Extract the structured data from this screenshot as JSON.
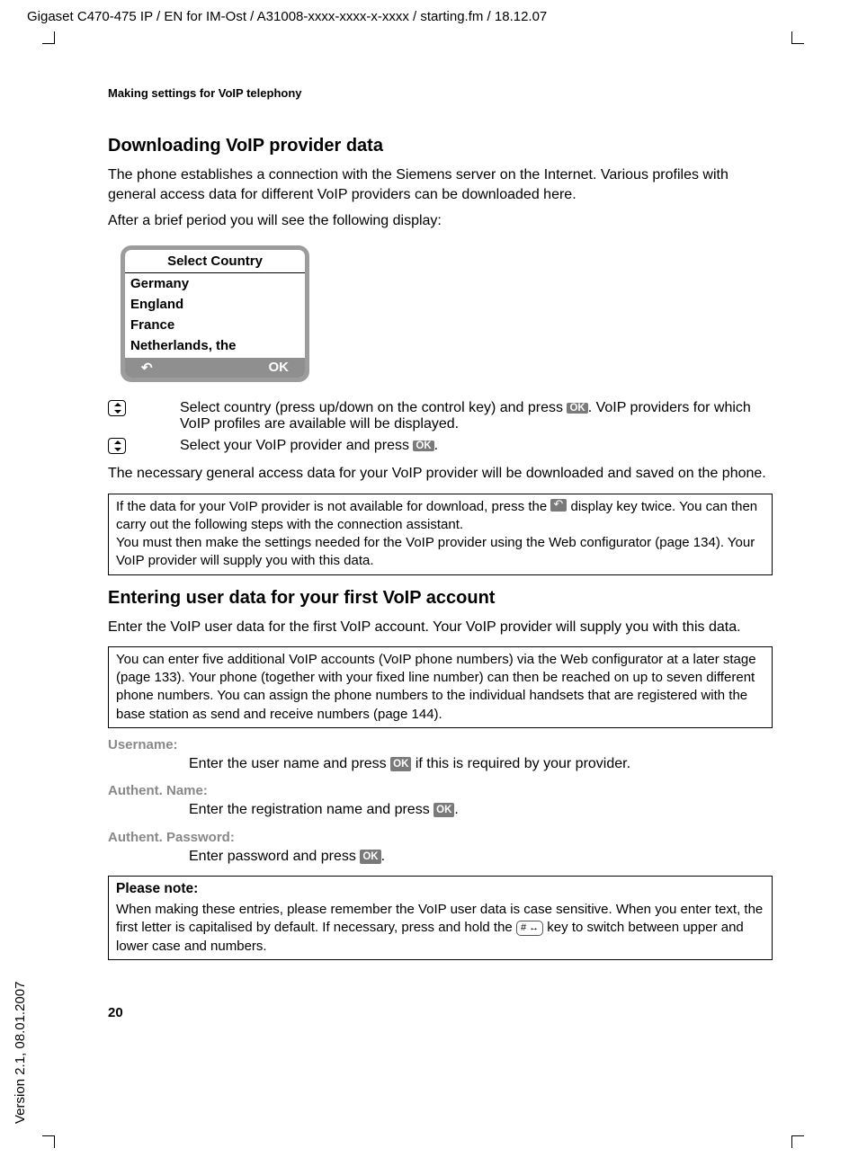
{
  "runningHead": "Gigaset C470-475 IP / EN for IM-Ost / A31008-xxxx-xxxx-x-xxxx / starting.fm / 18.12.07",
  "versionSide": "Version 2.1, 08.01.2007",
  "sectionHeader": "Making settings for VoIP telephony",
  "h2a": "Downloading VoIP provider data",
  "p1": "The phone establishes a connection with the Siemens server on the Internet. Various profiles with general access data for different VoIP providers can be downloaded here.",
  "p2": "After a brief period you will see the following display:",
  "display": {
    "title": "Select Country",
    "items": [
      "Germany",
      "England",
      "France",
      "Netherlands, the"
    ],
    "softLeft": "↶",
    "softRight": "OK"
  },
  "instr1a": "Select country (press up/down on the control key) and press ",
  "instr1b": ". VoIP providers for which VoIP profiles are available will be displayed.",
  "instr2a": "Select your VoIP provider and press ",
  "instr2b": ".",
  "p3": "The necessary general access data for your VoIP provider will be downloaded and saved on the phone.",
  "note1a": "If the data for your VoIP provider is not available for download, press the ",
  "note1b": " display key twice. You can then carry out the following steps with the connection assistant.",
  "note1c": "You must then make the settings needed for the VoIP provider using the Web configurator (page 134). Your VoIP provider will supply you with this data.",
  "h2b": "Entering user data for your first VoIP account",
  "p4": "Enter the VoIP user data for the first VoIP account. Your VoIP provider will supply you with this data.",
  "note2": "You can enter five additional VoIP accounts (VoIP phone numbers) via the Web configurator at a later stage (page 133). Your phone (together with your fixed line number) can then be reached on up to seven different phone numbers. You can assign the phone numbers to the individual handsets that are registered with the base station as send and receive numbers (page 144).",
  "fields": {
    "username": {
      "label": "Username:",
      "desc_a": "Enter the user name and press ",
      "desc_b": " if this is required by your provider."
    },
    "authname": {
      "label": "Authent. Name:",
      "desc_a": "Enter the registration name and press ",
      "desc_b": "."
    },
    "authpass": {
      "label": "Authent. Password:",
      "desc_a": "Enter password and press ",
      "desc_b": "."
    }
  },
  "pleaseNoteTitle": "Please note:",
  "pleaseNote_a": "When making these entries, please remember the VoIP user data is case sensitive. When you enter text, the first letter is capitalised by default. If necessary, press and hold the ",
  "hashKey": "# ↔",
  "pleaseNote_b": " key to switch between upper and lower case and numbers.",
  "okChip": "OK",
  "pageNum": "20"
}
